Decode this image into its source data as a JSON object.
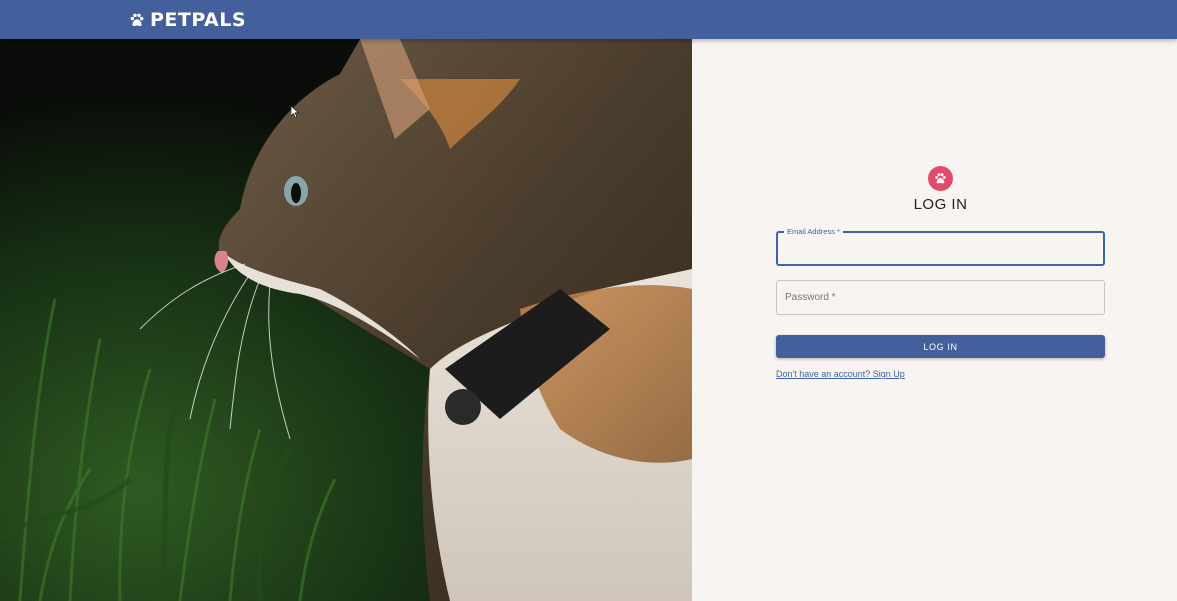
{
  "header": {
    "brand_name": "PETPALS",
    "brand_icon": "paw-icon"
  },
  "colors": {
    "header_bg": "#44609c",
    "accent": "#3e63a8",
    "avatar_bg": "#e04d6c",
    "panel_bg": "#f8f4f2"
  },
  "hero": {
    "image": "cat-photo",
    "subject": "calico cat with collar in grass"
  },
  "login": {
    "avatar_icon": "paw-icon",
    "title": "LOG IN",
    "email": {
      "label": "Email Address *",
      "value": "",
      "focused": true
    },
    "password": {
      "label": "Password *",
      "value": ""
    },
    "submit_label": "LOG IN",
    "signup_link": "Don't have an account? Sign Up"
  }
}
